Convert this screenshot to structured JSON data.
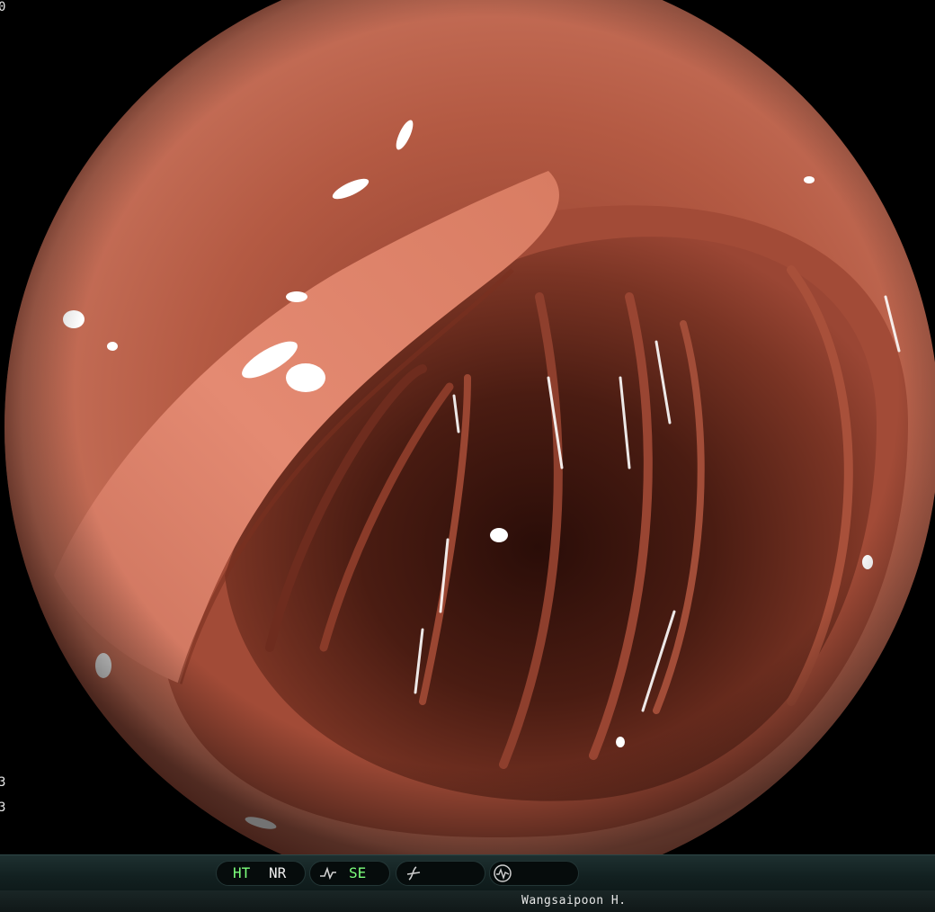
{
  "edge_digits": [
    "0",
    "3",
    "3"
  ],
  "status_bar": {
    "ht_label": "HT",
    "nr_label": "NR",
    "se_label": "SE",
    "operator": "Wangsaipoon H.",
    "accent_green": "#7cff7c",
    "text_white": "#f0f0f0",
    "icons": [
      "structure-enhance-icon",
      "color-mode-icon",
      "waveform-icon"
    ]
  },
  "scene": {
    "subject": "colon-lumen-endoscopic-view",
    "mucosa_color": "#b85a44",
    "lumen_color": "#2a0f0a"
  }
}
